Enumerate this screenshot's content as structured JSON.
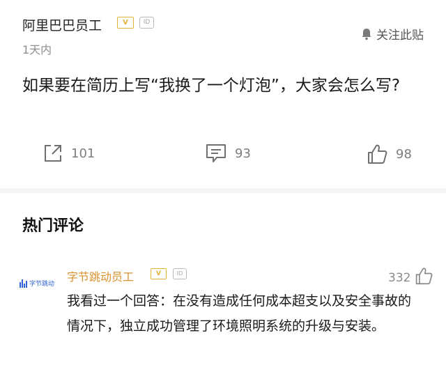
{
  "post": {
    "author": "阿里巴巴员工",
    "v_badge": "V",
    "id_badge": "ID",
    "time": "1天内",
    "follow_label": "关注此贴",
    "content": "如果要在简历上写“我换了一个灯泡”，大家会怎么写?",
    "stats": {
      "shares": "101",
      "comments": "93",
      "likes": "98"
    },
    "icons": {
      "share": "share-icon",
      "comment": "comment-icon",
      "like": "thumbs-up-icon",
      "follow": "bell-icon"
    }
  },
  "comments_section": {
    "title": "热门评论",
    "items": [
      {
        "avatar_text": "字节跳动",
        "author": "字节跳动员工",
        "v_badge": "V",
        "id_badge": "ID",
        "likes": "332",
        "text": "我看过一个回答：在没有造成任何成本超支以及安全事故的情况下，独立成功管理了环境照明系统的升级与安装。"
      }
    ]
  },
  "colors": {
    "badge_gold": "#e4b23a",
    "company_orange": "#d9902c",
    "bytedance_blue": "#2f63d6"
  }
}
